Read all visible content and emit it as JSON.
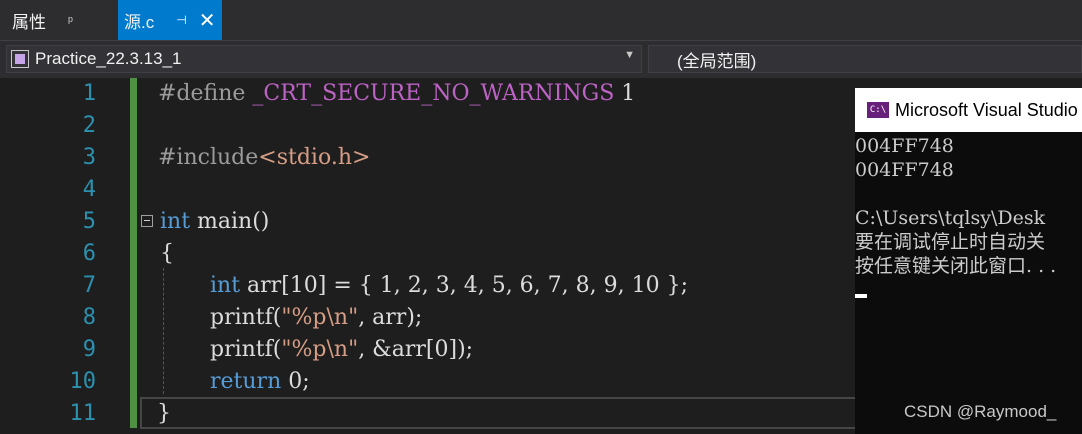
{
  "tabs": {
    "properties_label": "属性",
    "properties_pin": "ᵖ",
    "source_label": "源.c",
    "source_pin": "⊣",
    "source_close": "✕"
  },
  "navbar": {
    "project": "Practice_22.3.13_1",
    "scope": "(全局范围)"
  },
  "editor": {
    "line_numbers": [
      "1",
      "2",
      "3",
      "4",
      "5",
      "6",
      "7",
      "8",
      "9",
      "10",
      "11"
    ],
    "lines": {
      "l1_directive": "#define",
      "l1_macro": "_CRT_SECURE_NO_WARNINGS",
      "l1_value": " 1",
      "l3_directive": "#include",
      "l3_header": "<stdio.h>",
      "l5_kw": "int",
      "l5_rest": " main()",
      "l6": "{",
      "l7_kw": "int",
      "l7_rest": " arr[10] = { 1, 2, 3, 4, 5, 6, 7, 8, 9, 10 };",
      "l8_fn": "printf(",
      "l8_str": "\"%p\\n\"",
      "l8_rest": ", arr);",
      "l9_fn": "printf(",
      "l9_str": "\"%p\\n\"",
      "l9_rest": ", &arr[0]);",
      "l10_kw": "return",
      "l10_rest": " 0;",
      "l11": "}"
    }
  },
  "console": {
    "icon": "C:\\",
    "title": "Microsoft Visual Studio",
    "lines": [
      "004FF748",
      "004FF748",
      "",
      "C:\\Users\\tqlsy\\Desk",
      "要在调试停止时自动关",
      "按任意键关闭此窗口. . ."
    ]
  },
  "watermark": "CSDN @Raymood_",
  "colors": {
    "accent": "#007acc",
    "keyword": "#569cd6",
    "macro": "#bd63c5",
    "string": "#d69d85",
    "line_number": "#2b91af",
    "change_bar": "#57a64a"
  }
}
